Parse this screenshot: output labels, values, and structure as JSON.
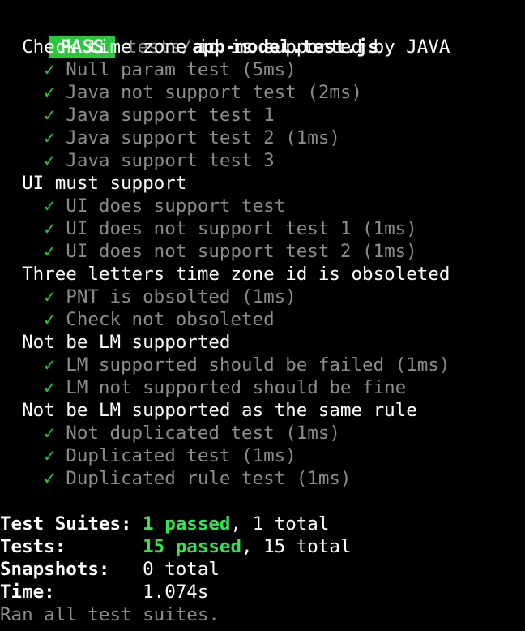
{
  "header": {
    "status": "PASS",
    "path_prefix": "tests/",
    "file_name": "app-model.test.js"
  },
  "check_glyph": "✓",
  "suites": [
    {
      "name": "Check time zone id is supported by JAVA",
      "tests": [
        "Null param test (5ms)",
        "Java not support test (2ms)",
        "Java support test 1",
        "Java support test 2 (1ms)",
        "Java support test 3"
      ]
    },
    {
      "name": "UI must support",
      "tests": [
        "UI does support test",
        "UI does not support test 1 (1ms)",
        "UI does not support test 2 (1ms)"
      ]
    },
    {
      "name": "Three letters time zone id is obsoleted",
      "tests": [
        "PNT is obsolted (1ms)",
        "Check not obsoleted"
      ]
    },
    {
      "name": "Not be LM supported",
      "tests": [
        "LM supported should be failed (1ms)",
        "LM not supported should be fine"
      ]
    },
    {
      "name": "Not be LM supported as the same rule",
      "tests": [
        "Not duplicated test (1ms)",
        "Duplicated test (1ms)",
        "Duplicated rule test (1ms)"
      ]
    }
  ],
  "summary": {
    "suites_label": "Test Suites:",
    "suites_passed": "1 passed",
    "suites_total": ", 1 total",
    "tests_label": "Tests:",
    "tests_passed": "15 passed",
    "tests_total": ", 15 total",
    "snapshots_label": "Snapshots:",
    "snapshots_value": "0 total",
    "time_label": "Time:",
    "time_value": "1.074s",
    "ran_all": "Ran all test suites."
  },
  "colors": {
    "background": "#000000",
    "pass_badge": "#26c93a",
    "passed_text": "#33e64d",
    "dim_text": "#8c8c8c"
  }
}
